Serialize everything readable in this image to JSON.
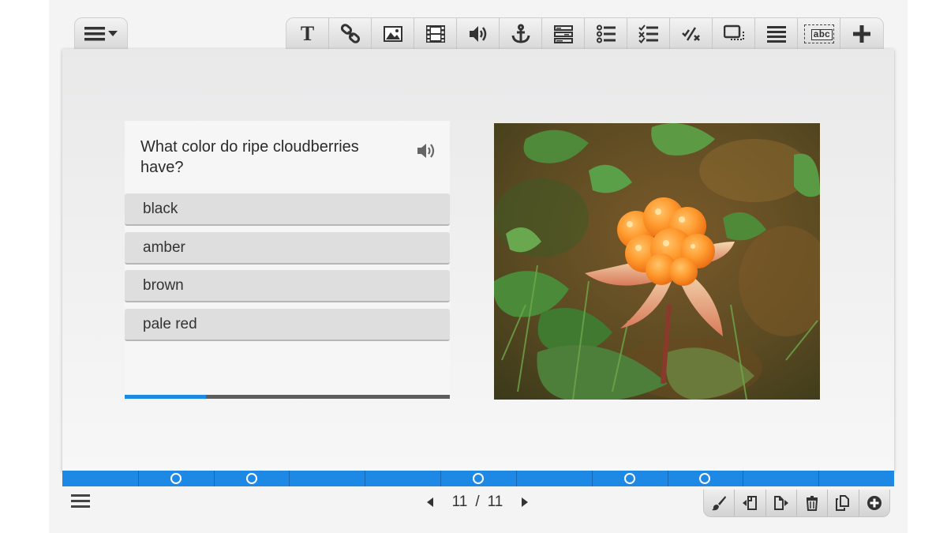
{
  "toolbar": {
    "items": [
      {
        "name": "text-icon",
        "label": "T"
      },
      {
        "name": "link-icon"
      },
      {
        "name": "image-icon"
      },
      {
        "name": "video-icon"
      },
      {
        "name": "audio-icon"
      },
      {
        "name": "anchor-icon"
      },
      {
        "name": "form-fields-icon"
      },
      {
        "name": "list-icon"
      },
      {
        "name": "checklist-icon"
      },
      {
        "name": "true-false-icon"
      },
      {
        "name": "drag-drop-icon"
      },
      {
        "name": "lines-icon"
      },
      {
        "name": "fill-blank-icon",
        "label": "abc"
      },
      {
        "name": "add-icon"
      }
    ]
  },
  "quiz": {
    "question": "What color do ripe cloudberries have?",
    "answers": [
      "black",
      "amber",
      "brown",
      "pale red"
    ],
    "progress_fraction": 0.25
  },
  "photo": {
    "subject": "cloudberry"
  },
  "timeline": {
    "segments": 11,
    "dots_at_segments": [
      1,
      2,
      5,
      7,
      8
    ]
  },
  "pager": {
    "current": "11",
    "separator": "/",
    "total": "11"
  },
  "colors": {
    "accent": "#1e88e5",
    "toolbar_bg": "#e4e4e4",
    "answer_bg": "#dedede",
    "canvas_bg": "#efefef"
  }
}
